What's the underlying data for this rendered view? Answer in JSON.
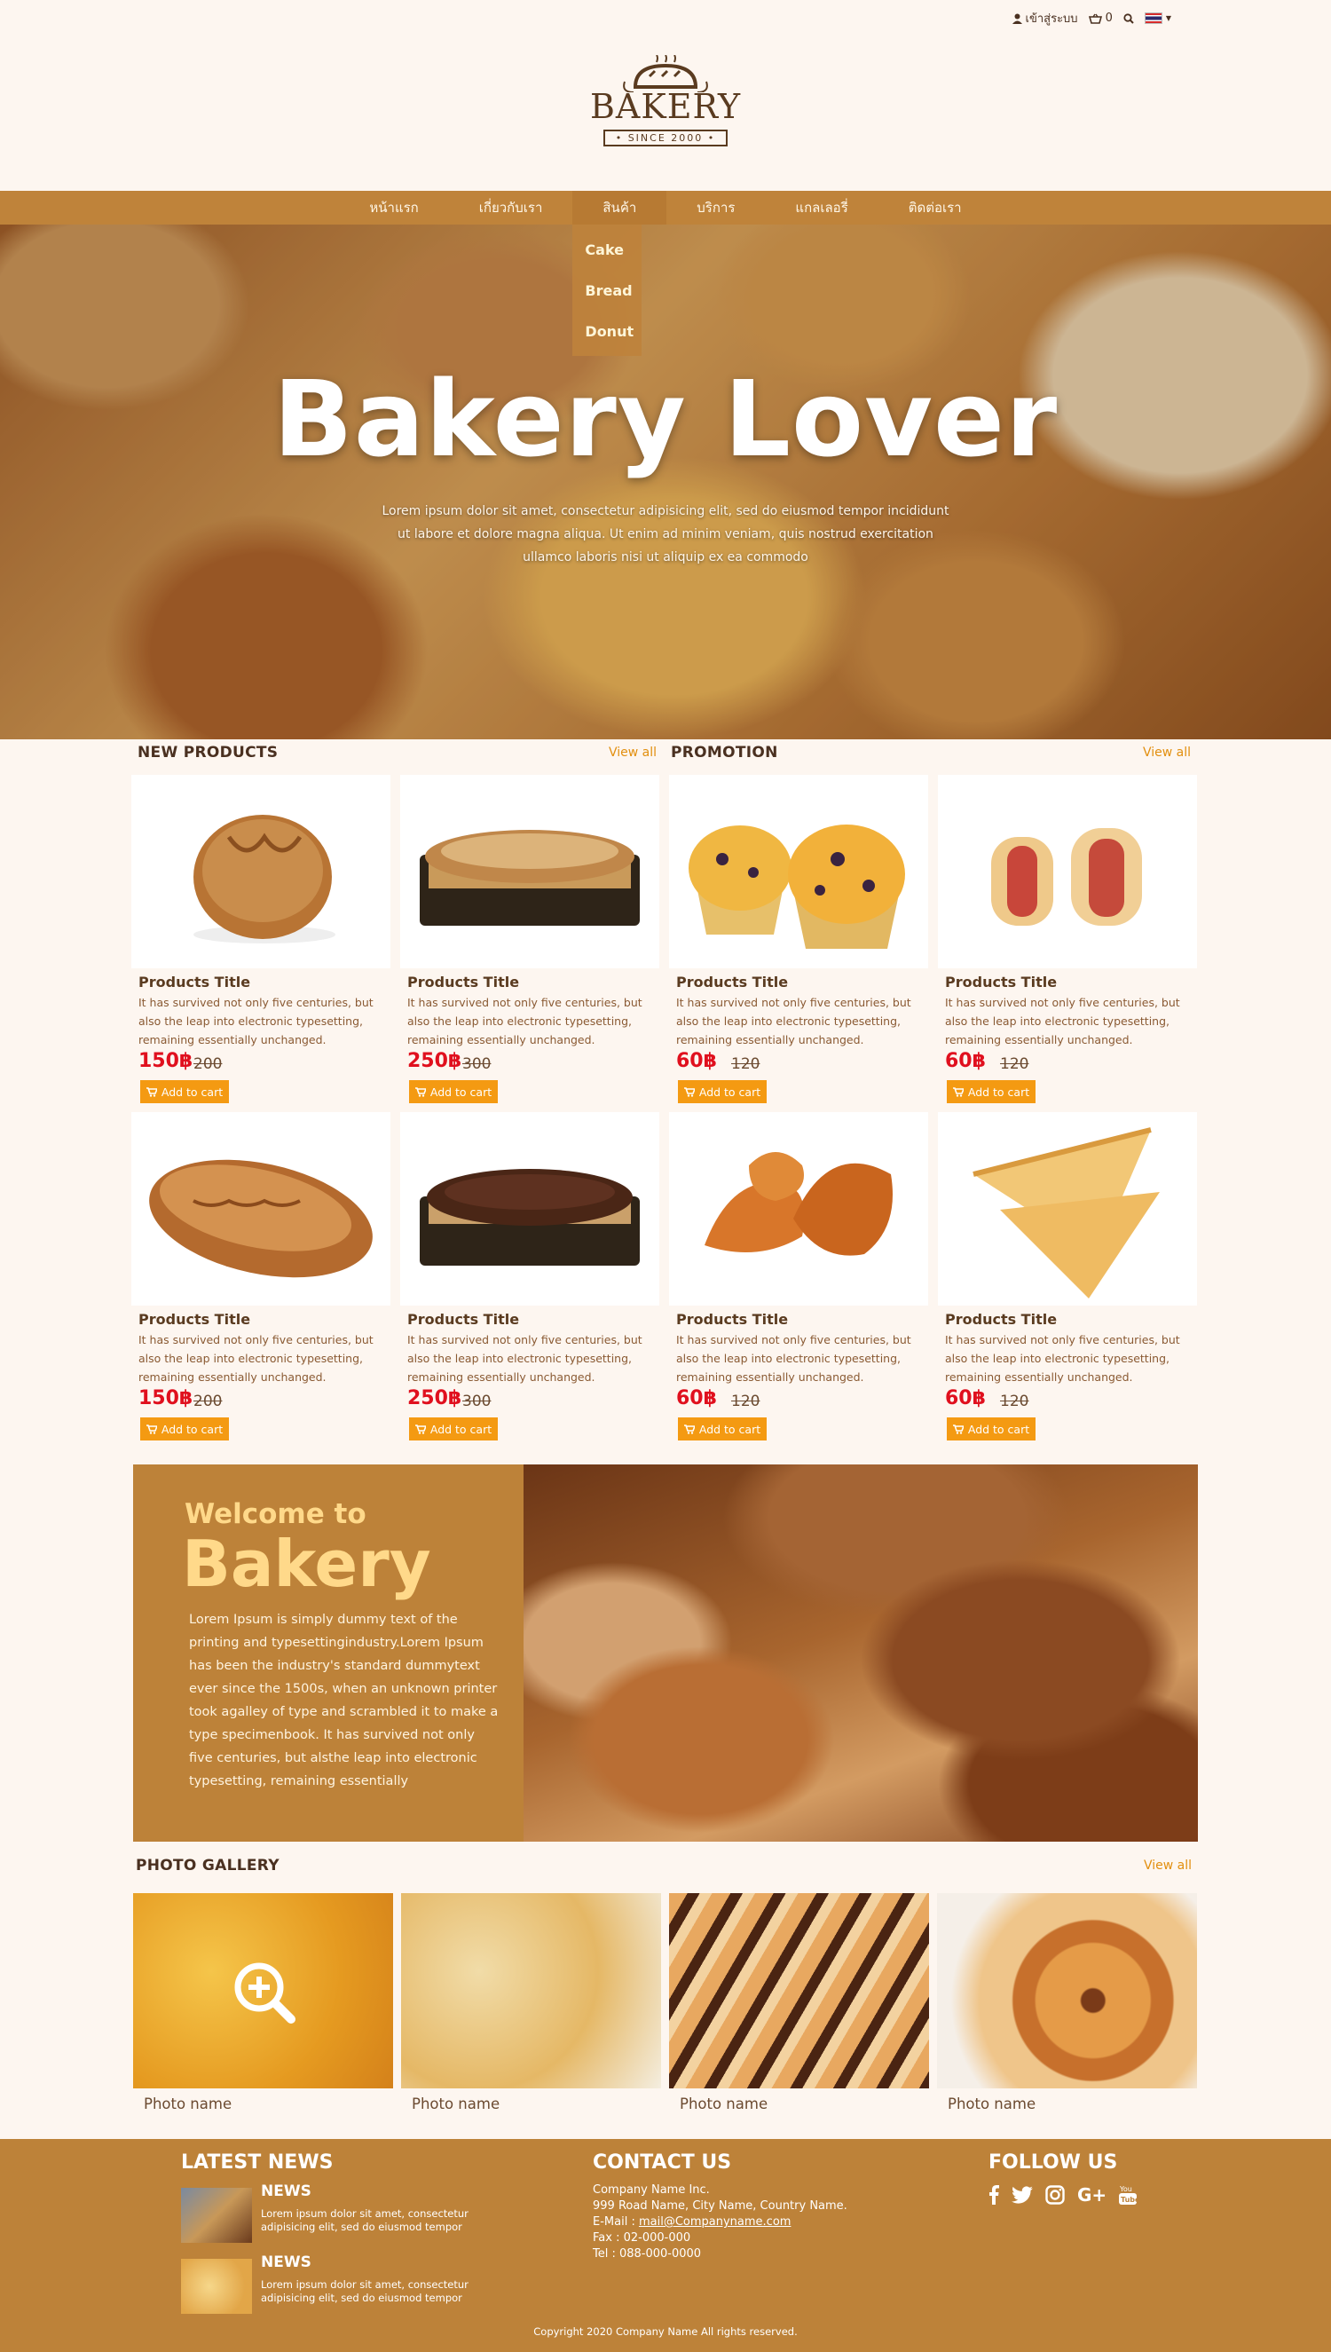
{
  "topbar": {
    "login": "เข้าสู่ระบบ",
    "cart_count": "0"
  },
  "logo": {
    "brand": "BAKERY",
    "since": "• SINCE 2000 •"
  },
  "nav": {
    "items": [
      {
        "label": "หน้าแรก"
      },
      {
        "label": "เกี่ยวกับเรา"
      },
      {
        "label": "สินค้า"
      },
      {
        "label": "บริการ"
      },
      {
        "label": "แกลเลอรี่"
      },
      {
        "label": "ติดต่อเรา"
      }
    ],
    "dropdown": [
      "Cake",
      "Bread",
      "Donut"
    ]
  },
  "hero": {
    "title": "Bakery Lover",
    "text": "Lorem ipsum dolor sit amet, consectetur adipisicing elit, sed do eiusmod tempor incididunt ut labore et dolore magna aliqua. Ut enim ad minim veniam, quis nostrud exercitation ullamco laboris nisi ut aliquip ex ea commodo"
  },
  "sections": {
    "new_products": "NEW PRODUCTS",
    "promotion": "PROMOTION",
    "view_all": "View all",
    "photo_gallery": "PHOTO GALLERY"
  },
  "products": [
    {
      "title": "Products Title",
      "desc": "It has survived not only five centuries, but also the leap into electronic typesetting, remaining essentially unchanged.",
      "price": "150฿",
      "old": "200",
      "cart": "Add to cart"
    },
    {
      "title": "Products Title",
      "desc": "It has survived not only five centuries, but also the leap into electronic typesetting, remaining essentially unchanged.",
      "price": "250฿",
      "old": "300",
      "cart": "Add to cart"
    },
    {
      "title": "Products Title",
      "desc": "It has survived not only five centuries, but also the leap into electronic typesetting, remaining essentially unchanged.",
      "price": "60฿",
      "old": "120",
      "cart": "Add to cart"
    },
    {
      "title": "Products Title",
      "desc": "It has survived not only five centuries, but also the leap into electronic typesetting, remaining essentially unchanged.",
      "price": "60฿",
      "old": "120",
      "cart": "Add to cart"
    },
    {
      "title": "Products Title",
      "desc": "It has survived not only five centuries, but also the leap into electronic typesetting, remaining essentially unchanged.",
      "price": "150฿",
      "old": "200",
      "cart": "Add to cart"
    },
    {
      "title": "Products Title",
      "desc": "It has survived not only five centuries, but also the leap into electronic typesetting, remaining essentially unchanged.",
      "price": "250฿",
      "old": "300",
      "cart": "Add to cart"
    },
    {
      "title": "Products Title",
      "desc": "It has survived not only five centuries, but also the leap into electronic typesetting, remaining essentially unchanged.",
      "price": "60฿",
      "old": "120",
      "cart": "Add to cart"
    },
    {
      "title": "Products Title",
      "desc": "It has survived not only five centuries, but also the leap into electronic typesetting, remaining essentially unchanged.",
      "price": "60฿",
      "old": "120",
      "cart": "Add to cart"
    }
  ],
  "welcome": {
    "line1": "Welcome to",
    "line2": "Bakery",
    "text": "Lorem Ipsum is simply dummy text of the printing and typesettingindustry.Lorem Ipsum has been the industry's standard dummytext ever since the 1500s, when an unknown printer took agalley of type and scrambled it to make a type specimenbook. It has survived not only five centuries, but alsthe leap into electronic typesetting, remaining essentially"
  },
  "gallery": [
    {
      "name": "Photo name"
    },
    {
      "name": "Photo name"
    },
    {
      "name": "Photo name"
    },
    {
      "name": "Photo name"
    }
  ],
  "footer": {
    "news_title": "LATEST NEWS",
    "news": [
      {
        "title": "NEWS",
        "desc": "Lorem ipsum dolor sit amet, consectetur adipisicing elit, sed do eiusmod tempor"
      },
      {
        "title": "NEWS",
        "desc": "Lorem ipsum dolor sit amet, consectetur adipisicing elit, sed do eiusmod tempor"
      }
    ],
    "contact_title": "CONTACT US",
    "company": "Company Name Inc.",
    "address": "999 Road Name, City Name, Country Name.",
    "email_label": "E-Mail :",
    "email": "mail@Companyname.com",
    "fax": "Fax : 02-000-000",
    "tel": "Tel : 088-000-0000",
    "follow_title": "FOLLOW US",
    "copyright": "Copyright 2020 Company Name All rights reserved."
  },
  "colors": {
    "accent": "#bd8239",
    "cart_button": "#f49a12",
    "price": "#e0101e",
    "view_all": "#e28f0f",
    "background": "#fdf6f0"
  }
}
